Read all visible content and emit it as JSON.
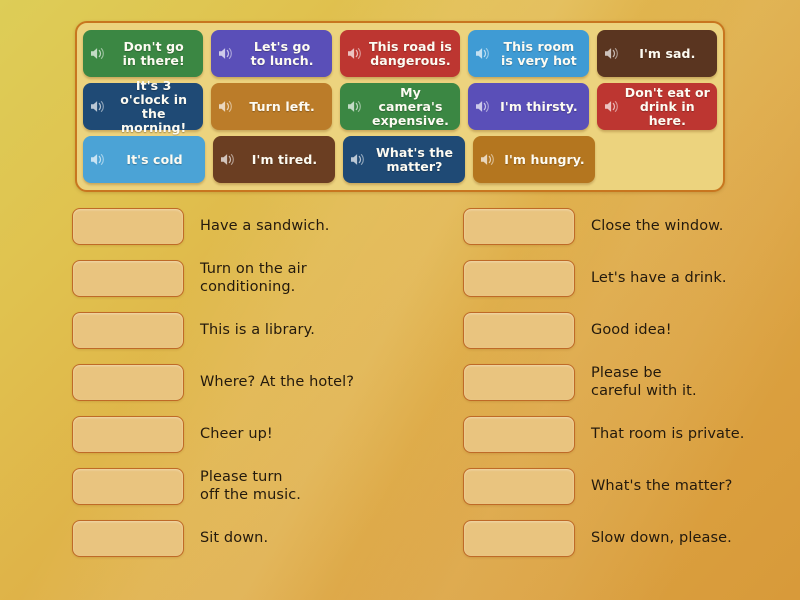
{
  "activity": {
    "type": "match-up",
    "tile_bank": {
      "icon": "speaker-icon",
      "tiles": [
        {
          "text": "Don't go\nin there!",
          "color": "#3b8743"
        },
        {
          "text": "Let's go\nto lunch.",
          "color": "#5a4fb8"
        },
        {
          "text": "This road is\ndangerous.",
          "color": "#bd3631"
        },
        {
          "text": "This room\nis very hot",
          "color": "#3f9bd4"
        },
        {
          "text": "I'm sad.",
          "color": "#5a3520"
        },
        {
          "text": "It's 3 o'clock in\nthe morning!",
          "color": "#1f4a75"
        },
        {
          "text": "Turn left.",
          "color": "#bb7c29"
        },
        {
          "text": "My camera's\nexpensive.",
          "color": "#3b8743"
        },
        {
          "text": "I'm thirsty.",
          "color": "#5a4fb8"
        },
        {
          "text": "Don't eat or\ndrink in here.",
          "color": "#bd3631"
        },
        {
          "text": "It's cold",
          "color": "#4ba3d6"
        },
        {
          "text": "I'm tired.",
          "color": "#6b3e22"
        },
        {
          "text": "What's the\nmatter?",
          "color": "#1f4a75"
        },
        {
          "text": "I'm hungry.",
          "color": "#b4761f"
        }
      ]
    },
    "answers": {
      "left_column": [
        {
          "prompt": "Have a sandwich.",
          "drop_value": ""
        },
        {
          "prompt": "Turn on the air\nconditioning.",
          "drop_value": ""
        },
        {
          "prompt": "This is a library.",
          "drop_value": ""
        },
        {
          "prompt": "Where? At the hotel?",
          "drop_value": ""
        },
        {
          "prompt": "Cheer up!",
          "drop_value": ""
        },
        {
          "prompt": "Please turn\noff the music.",
          "drop_value": ""
        },
        {
          "prompt": "Sit down.",
          "drop_value": ""
        }
      ],
      "right_column": [
        {
          "prompt": "Close the window.",
          "drop_value": ""
        },
        {
          "prompt": "Let's have a drink.",
          "drop_value": ""
        },
        {
          "prompt": "Good idea!",
          "drop_value": ""
        },
        {
          "prompt": "Please be\ncareful with it.",
          "drop_value": ""
        },
        {
          "prompt": "That room is private.",
          "drop_value": ""
        },
        {
          "prompt": "What's the matter?",
          "drop_value": ""
        },
        {
          "prompt": "Slow down, please.",
          "drop_value": ""
        }
      ]
    },
    "colors": {
      "background_start": "#ddcd57",
      "background_end": "#d89a3a",
      "panel_fill": "#ecd37e",
      "panel_border": "#c8761f",
      "dropzone_fill": "#e9c47f",
      "dropzone_border": "#bf6a27",
      "answer_text": "#241a0d",
      "tile_text": "#fdfbf2"
    }
  }
}
